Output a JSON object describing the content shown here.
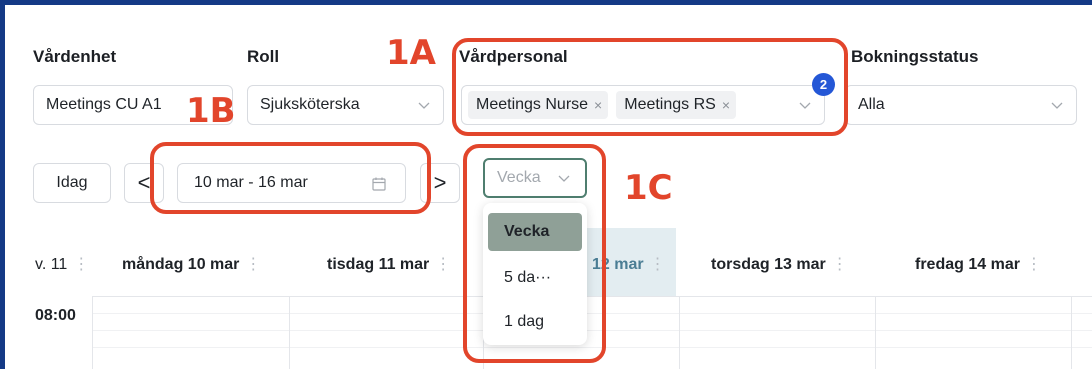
{
  "filters": {
    "vardenhet_label": "Vårdenhet",
    "vardenhet_value": "Meetings CU A1",
    "roll_label": "Roll",
    "roll_value": "Sjuksköterska",
    "vardpersonal_label": "Vårdpersonal",
    "vardpersonal_tags": [
      "Meetings Nurse",
      "Meetings RS"
    ],
    "vardpersonal_count": "2",
    "bokningsstatus_label": "Bokningsstatus",
    "bokningsstatus_value": "Alla",
    "tag_remove": "×"
  },
  "toolbar": {
    "today_label": "Idag",
    "prev_label": "<",
    "next_label": ">",
    "date_range": "10 mar - 16 mar",
    "view_value": "Vecka"
  },
  "view_options": [
    {
      "label": "Vecka",
      "selected": true
    },
    {
      "label": "5 da···",
      "selected": false
    },
    {
      "label": "1 dag",
      "selected": false
    }
  ],
  "calendar": {
    "week_label": "v. 11",
    "days": [
      "måndag 10 mar",
      "tisdag 11 mar",
      "12 mar",
      "torsdag 13 mar",
      "fredag 14 mar"
    ],
    "first_time": "08:00",
    "menu_glyph": "⋮",
    "today_highlight": "#e3edf1"
  },
  "annotations": {
    "a1": "1A",
    "b1": "1B",
    "c1": "1C",
    "color": "#e2452b"
  }
}
